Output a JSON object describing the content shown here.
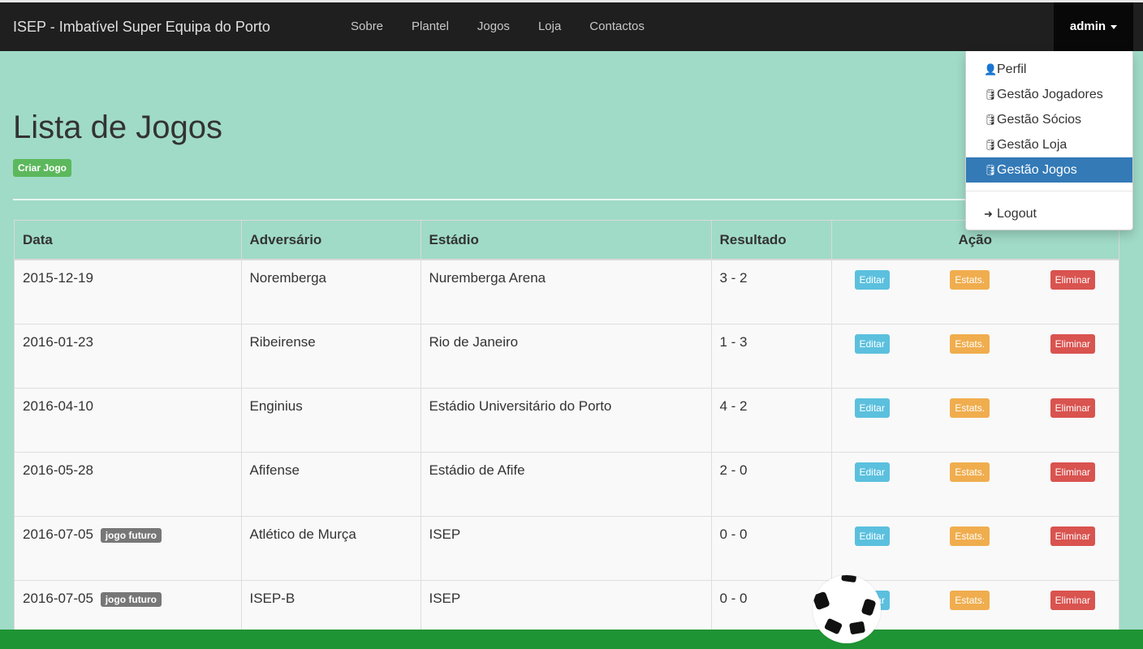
{
  "navbar": {
    "brand": "ISEP - Imbatível Super Equipa do Porto",
    "links": [
      "Sobre",
      "Plantel",
      "Jogos",
      "Loja",
      "Contactos"
    ],
    "user_label": "admin"
  },
  "dropdown": {
    "items": [
      {
        "label": "Perfil",
        "icon": "user-icon",
        "glyph": "👤"
      },
      {
        "label": "Gestão Jogadores",
        "icon": "database-icon",
        "glyph": "🛢"
      },
      {
        "label": "Gestão Sócios",
        "icon": "database-icon",
        "glyph": "🛢"
      },
      {
        "label": "Gestão Loja",
        "icon": "database-icon",
        "glyph": "🛢"
      },
      {
        "label": "Gestão Jogos",
        "icon": "database-icon",
        "glyph": "🛢"
      }
    ],
    "active_label": "Gestão Jogos",
    "logout": {
      "label": "Logout",
      "icon": "logout-icon",
      "glyph": "➜"
    }
  },
  "page": {
    "title": "Lista de Jogos",
    "create_button": "Criar Jogo"
  },
  "table": {
    "headers": {
      "data": "Data",
      "adversario": "Adversário",
      "estadio": "Estádio",
      "resultado": "Resultado",
      "acao": "Ação"
    },
    "future_badge": "jogo futuro",
    "buttons": {
      "edit": "Editar",
      "stats": "Estats.",
      "delete": "Eliminar"
    },
    "rows": [
      {
        "date": "2015-12-19",
        "future": false,
        "opponent": "Noremberga",
        "stadium": "Nuremberga Arena",
        "result": "3 - 2"
      },
      {
        "date": "2016-01-23",
        "future": false,
        "opponent": "Ribeirense",
        "stadium": "Rio de Janeiro",
        "result": "1 - 3"
      },
      {
        "date": "2016-04-10",
        "future": false,
        "opponent": "Enginius",
        "stadium": "Estádio Universitário do Porto",
        "result": "4 - 2"
      },
      {
        "date": "2016-05-28",
        "future": false,
        "opponent": "Afifense",
        "stadium": "Estádio de Afife",
        "result": "2 - 0"
      },
      {
        "date": "2016-07-05",
        "future": true,
        "opponent": "Atlético de Murça",
        "stadium": "ISEP",
        "result": "0 - 0"
      },
      {
        "date": "2016-07-05",
        "future": true,
        "opponent": "ISEP-B",
        "stadium": "ISEP",
        "result": "0 - 0"
      }
    ]
  },
  "colors": {
    "background": "#a0dbc7",
    "navbar": "#1f1f1f",
    "active_menu": "#337ab7",
    "success": "#5cb85c",
    "info": "#5bc0de",
    "warning": "#f0ad4e",
    "danger": "#d9534f",
    "footer": "#1f9434"
  }
}
